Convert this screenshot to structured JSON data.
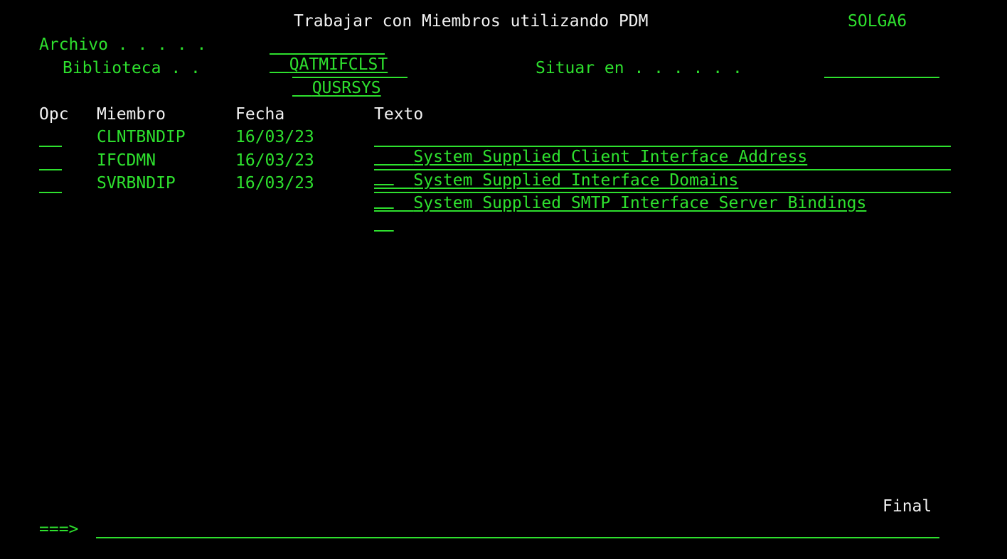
{
  "header": {
    "title": "Trabajar con Miembros utilizando PDM",
    "system": "SOLGA6"
  },
  "archivo": {
    "label": "Archivo . . . . .",
    "value": "QATMIFCLST"
  },
  "biblioteca": {
    "label": "Biblioteca . .",
    "value": "QUSRSYS"
  },
  "situar": {
    "label": "Situar en . . . . . .",
    "value": ""
  },
  "columns": {
    "opc": "Opc",
    "miembro": "Miembro",
    "fecha": "Fecha",
    "texto": "Texto"
  },
  "rows": [
    {
      "opc": "",
      "miembro": "CLNTBNDIP",
      "fecha": "16/03/23",
      "texto": "System Supplied Client Interface Address"
    },
    {
      "opc": "",
      "miembro": "IFCDMN",
      "fecha": "16/03/23",
      "texto": "System Supplied Interface Domains"
    },
    {
      "opc": "",
      "miembro": "SVRBNDIP",
      "fecha": "16/03/23",
      "texto": "System Supplied SMTP Interface Server Bindings"
    }
  ],
  "footer": {
    "status": "Final",
    "prompt": "===>",
    "command": ""
  },
  "colors": {
    "background": "#000000",
    "field_green": "#2ee02e",
    "text_white": "#f2f2f2"
  }
}
